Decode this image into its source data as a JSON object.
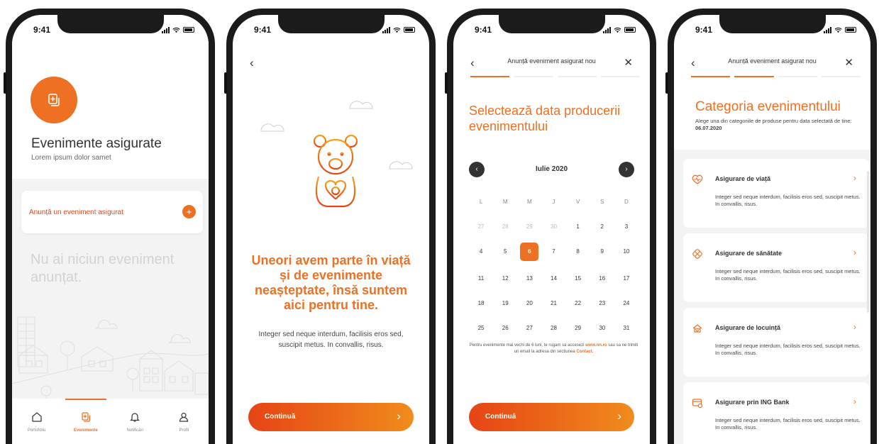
{
  "status": {
    "time": "9:41"
  },
  "colors": {
    "accent": "#ee7023",
    "accent_dark": "#e64415",
    "text": "#333333"
  },
  "screen1": {
    "title": "Evenimente asigurate",
    "subtitle": "Lorem ipsum dolor samet",
    "announce_label": "Anunță un eveniment asigurat",
    "announce_plus": "+",
    "empty_text": "Nu ai niciun eveniment anunțat.",
    "tabs": [
      {
        "label": "Portofoliu",
        "icon": "home-icon"
      },
      {
        "label": "Evenimente",
        "icon": "events-icon",
        "active": true
      },
      {
        "label": "Notificări",
        "icon": "bell-icon"
      },
      {
        "label": "Profil",
        "icon": "user-icon"
      }
    ]
  },
  "screen2": {
    "back": "‹",
    "headline": "Uneori avem parte în viață și de evenimente neașteptate, însă suntem aici pentru tine.",
    "body": "Integer sed neque interdum, facilisis eros sed, suscipit metus. In convallis, risus.",
    "button": "Continuă",
    "button_arrow": "›"
  },
  "screen3": {
    "back": "‹",
    "nav_title": "Anunță eveniment asigurat nou",
    "close": "✕",
    "title": "Selectează data producerii evenimentului",
    "prev": "‹",
    "next": "›",
    "month": "Iulie 2020",
    "weekdays": [
      "L",
      "M",
      "M",
      "J",
      "V",
      "S",
      "D"
    ],
    "days": [
      "27",
      "28",
      "29",
      "30",
      "1",
      "2",
      "3",
      "4",
      "5",
      "6",
      "7",
      "8",
      "9",
      "10",
      "11",
      "12",
      "13",
      "14",
      "15",
      "16",
      "17",
      "18",
      "19",
      "20",
      "21",
      "22",
      "23",
      "24",
      "25",
      "26",
      "27",
      "28",
      "29",
      "30",
      "31"
    ],
    "muted_count": 4,
    "selected_index": 9,
    "note_a": "Pentru evenimente mai vechi de 6 luni, te rugam sa accesezi",
    "note_link": "www.nn.ro",
    "note_b": "sau sa ne trimiti un email la adresa din sectiunea",
    "note_contact": "Contact.",
    "button": "Continuă",
    "button_arrow": "›"
  },
  "screen4": {
    "back": "‹",
    "nav_title": "Anunță eveniment asigurat nou",
    "close": "✕",
    "title": "Categoria evenimentului",
    "subtitle": "Alege una din categoriile de produse pentru data selectată de tine:",
    "date": "06.07.2020",
    "categories": [
      {
        "name": "Asigurare de viață",
        "desc": "Integer sed neque interdum, facilisis eros sed, suscipit metus. In convallis, risus.",
        "icon": "heart-pulse-icon"
      },
      {
        "name": "Asigurare de sănătate",
        "desc": "Integer sed neque interdum, facilisis eros sed, suscipit metus. In convallis, risus.",
        "icon": "health-icon"
      },
      {
        "name": "Asigurare de locuință",
        "desc": "Integer sed neque interdum, facilisis eros sed, suscipit metus. In convallis, risus.",
        "icon": "house-icon"
      },
      {
        "name": "Asigurare prin ING Bank",
        "desc": "Integer sed neque interdum, facilisis eros sed, suscipit metus. In convallis, risus.",
        "icon": "bank-card-icon"
      }
    ],
    "chevron": "›"
  }
}
